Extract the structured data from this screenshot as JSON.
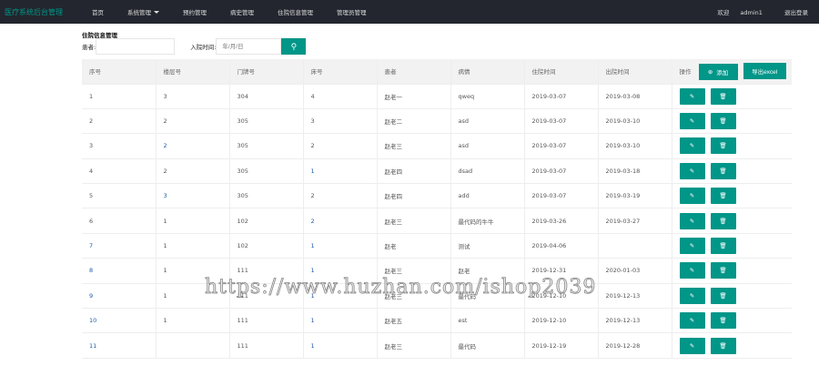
{
  "nav": {
    "logo": "医疗系统后台管理",
    "items": [
      "首页",
      "系统管理",
      "预约管理",
      "病史管理",
      "住院信息管理",
      "管理员管理"
    ],
    "welcome": "欢迎",
    "user": "admin1",
    "logout": "退出登录"
  },
  "page": {
    "title": "住院信息管理",
    "patient_label": "患者:",
    "patient_value": "",
    "date_label": "入院时间:",
    "date_placeholder": "年/月/日"
  },
  "table": {
    "headers": [
      "序号",
      "楼层号",
      "门牌号",
      "床号",
      "患者",
      "病情",
      "住院时间",
      "出院时间",
      "操作"
    ],
    "add": "添加",
    "export": "导出excel",
    "rows": [
      [
        "1",
        "3",
        "304",
        "4",
        "赵老一",
        "qweq",
        "2019-03-07",
        "2019-03-08"
      ],
      [
        "2",
        "2",
        "305",
        "3",
        "赵老二",
        "asd",
        "2019-03-07",
        "2019-03-10"
      ],
      [
        "3",
        "2",
        "305",
        "2",
        "赵老三",
        "asd",
        "2019-03-07",
        "2019-03-10"
      ],
      [
        "4",
        "2",
        "305",
        "1",
        "赵老四",
        "dsad",
        "2019-03-07",
        "2019-03-18"
      ],
      [
        "5",
        "3",
        "305",
        "2",
        "赵老四",
        "add",
        "2019-03-07",
        "2019-03-19"
      ],
      [
        "6",
        "1",
        "102",
        "2",
        "赵老三",
        "最代码的牛牛",
        "2019-03-26",
        "2019-03-27"
      ],
      [
        "7",
        "1",
        "102",
        "1",
        "赵老",
        "测试",
        "2019-04-06",
        ""
      ],
      [
        "8",
        "1",
        "111",
        "1",
        "赵老三",
        "赵老",
        "2019-12-31",
        "2020-01-03"
      ],
      [
        "9",
        "1",
        "111",
        "1",
        "赵老三",
        "最代码",
        "2019-12-10",
        "2019-12-13"
      ],
      [
        "10",
        "1",
        "111",
        "1",
        "赵老五",
        "est",
        "2019-12-10",
        "2019-12-13"
      ],
      [
        "11",
        "",
        "111",
        "1",
        "赵老三",
        "最代码",
        "2019-12-19",
        "2019-12-28"
      ]
    ]
  },
  "watermark": "https://www.huzhan.com/ishop2039",
  "colors": {
    "accent": "#009688",
    "nav": "#23262e"
  }
}
